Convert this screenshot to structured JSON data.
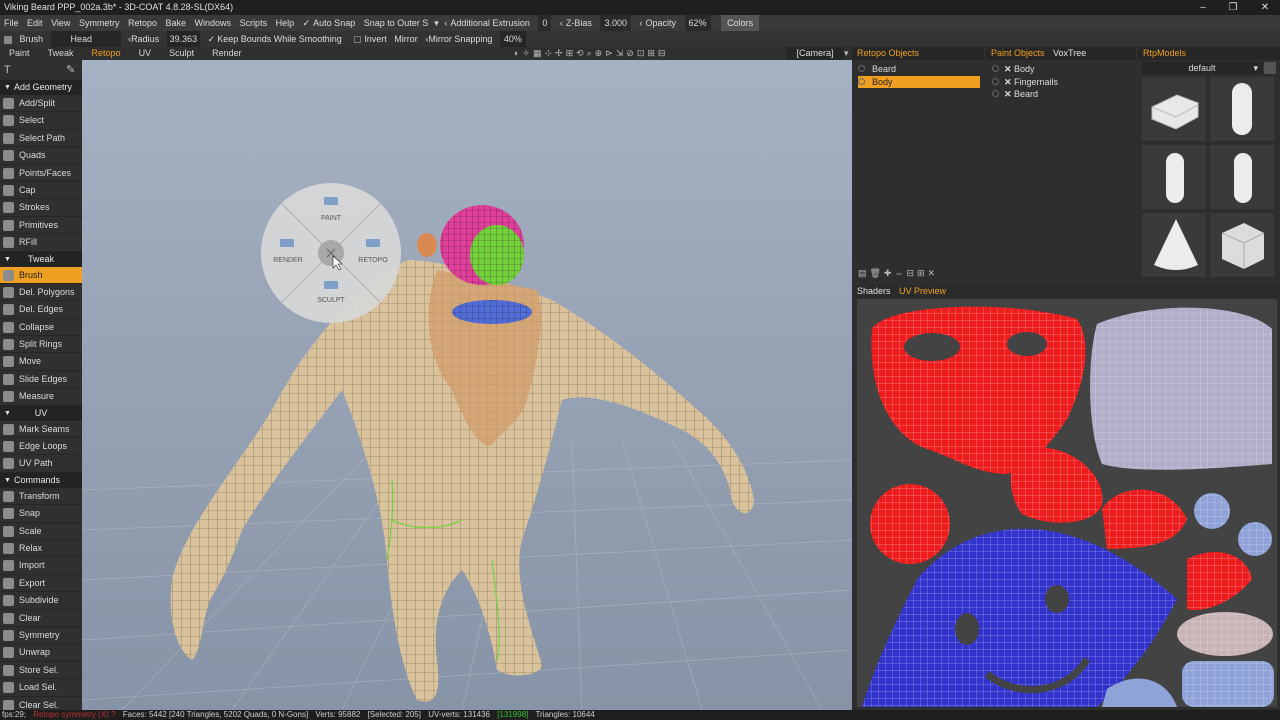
{
  "window": {
    "title": "Viking Beard PPP_002a.3b* - 3D-COAT 4.8.28-SL(DX64)",
    "min": "‒",
    "max": "❐",
    "close": "✕"
  },
  "menu": {
    "items": [
      "File",
      "Edit",
      "View",
      "Symmetry",
      "Retopo",
      "Bake",
      "Windows",
      "Scripts",
      "Help"
    ],
    "auto_snap": "Auto Snap",
    "snap_outer": "Snap to Outer S",
    "additional_extrusion": "Additional Extrusion",
    "additional_extrusion_value": "0",
    "zbias": "Z-Bias",
    "zbias_value": "3.000",
    "opacity": "Opacity",
    "opacity_value": "62%",
    "colors": "Colors"
  },
  "toolbar": {
    "brush": "Brush",
    "head": "Head",
    "radius": "Radius",
    "radius_value": "39.363",
    "keep_bounds": "Keep Bounds While Smoothing",
    "invert": "Invert",
    "mirror": "Mirror",
    "mirror_snapping": "Mirror Snapping",
    "mirror_snapping_value": "40%"
  },
  "tabs": [
    "Paint",
    "Tweak",
    "Retopo",
    "UV",
    "Sculpt",
    "Render"
  ],
  "active_tab": "Retopo",
  "camera": "[Camera]",
  "left_panel": [
    {
      "type": "section",
      "label": "Add Geometry"
    },
    {
      "type": "tool",
      "label": "Add/Split",
      "icon": "add-split-icon"
    },
    {
      "type": "tool",
      "label": "Select",
      "icon": "select-icon"
    },
    {
      "type": "tool",
      "label": "Select Path",
      "icon": "select-path-icon"
    },
    {
      "type": "tool",
      "label": "Quads",
      "icon": "quads-icon"
    },
    {
      "type": "tool",
      "label": "Points/Faces",
      "icon": "points-faces-icon"
    },
    {
      "type": "tool",
      "label": "Cap",
      "icon": "cap-icon"
    },
    {
      "type": "tool",
      "label": "Strokes",
      "icon": "strokes-icon"
    },
    {
      "type": "tool",
      "label": "Primitives",
      "icon": "primitives-icon"
    },
    {
      "type": "tool",
      "label": "RFill",
      "icon": "rfill-icon"
    },
    {
      "type": "section",
      "label": "Tweak"
    },
    {
      "type": "tool",
      "label": "Brush",
      "icon": "brush-icon",
      "active": true
    },
    {
      "type": "tool",
      "label": "Del. Polygons",
      "icon": "delete-polygons-icon"
    },
    {
      "type": "tool",
      "label": "Del. Edges",
      "icon": "delete-edges-icon"
    },
    {
      "type": "tool",
      "label": "Collapse",
      "icon": "collapse-icon"
    },
    {
      "type": "tool",
      "label": "Split Rings",
      "icon": "split-rings-icon"
    },
    {
      "type": "tool",
      "label": "Move",
      "icon": "move-icon"
    },
    {
      "type": "tool",
      "label": "Slide Edges",
      "icon": "slide-edges-icon"
    },
    {
      "type": "tool",
      "label": "Measure",
      "icon": "measure-icon"
    },
    {
      "type": "section",
      "label": "UV"
    },
    {
      "type": "tool",
      "label": "Mark Seams",
      "icon": "mark-seams-icon"
    },
    {
      "type": "tool",
      "label": "Edge Loops",
      "icon": "edge-loops-icon"
    },
    {
      "type": "tool",
      "label": "UV Path",
      "icon": "uv-path-icon"
    },
    {
      "type": "section",
      "label": "Commands"
    },
    {
      "type": "tool",
      "label": "Transform",
      "icon": "transform-icon"
    },
    {
      "type": "tool",
      "label": "Snap",
      "icon": "snap-icon"
    },
    {
      "type": "tool",
      "label": "Scale",
      "icon": "scale-icon"
    },
    {
      "type": "tool",
      "label": "Relax",
      "icon": "relax-icon"
    },
    {
      "type": "tool",
      "label": "Import",
      "icon": "import-icon"
    },
    {
      "type": "tool",
      "label": "Export",
      "icon": "export-icon"
    },
    {
      "type": "tool",
      "label": "Subdivide",
      "icon": "subdivide-icon"
    },
    {
      "type": "tool",
      "label": "Clear",
      "icon": "clear-icon"
    },
    {
      "type": "tool",
      "label": "Symmetry",
      "icon": "symmetry-icon"
    },
    {
      "type": "tool",
      "label": "Unwrap",
      "icon": "unwrap-icon"
    },
    {
      "type": "tool",
      "label": "Store Sel.",
      "icon": "store-selection-icon"
    },
    {
      "type": "tool",
      "label": "Load Sel.",
      "icon": "load-selection-icon"
    },
    {
      "type": "tool",
      "label": "Clear Sel.",
      "icon": "clear-selection-icon"
    }
  ],
  "pie_menu": {
    "top": "PAINT",
    "left": "RENDER",
    "right": "RETOPO",
    "bottom": "SCULPT"
  },
  "retopo_objects": {
    "title": "Retopo Objects",
    "items": [
      "Beard",
      "Body"
    ],
    "selected": "Body"
  },
  "paint_objects": {
    "title": "Paint Objects",
    "tab2": "VoxTree",
    "items": [
      "Body",
      "Fingernails",
      "Beard"
    ]
  },
  "rtp_models": {
    "title": "RtpModels",
    "preset": "default",
    "shapes": [
      "l-shape",
      "capsule",
      "cylinder",
      "capsule-short",
      "cone",
      "cube"
    ]
  },
  "bottom_tabs": [
    "Shaders",
    "UV Preview"
  ],
  "status": {
    "fps": "fps:29;",
    "warn": "Retopo symmetry (X) ?",
    "faces": "Faces: 5442 [240 Triangles, 5202 Quads, 0 N-Gons]",
    "verts": "Verts: 95882",
    "selected": "[Selected: 205]",
    "uv_verts": "UV-verts: 131436",
    "uv_verts_sel": "[131998]",
    "triangles": "Triangles: 10644"
  }
}
